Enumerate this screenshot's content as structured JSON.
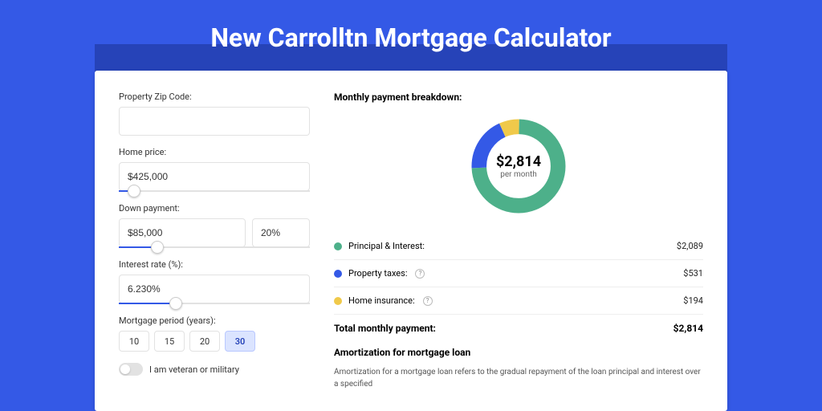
{
  "title": "New Carrolltn Mortgage Calculator",
  "form": {
    "zip": {
      "label": "Property Zip Code:",
      "value": ""
    },
    "price": {
      "label": "Home price:",
      "value": "$425,000",
      "slider_pct": 8
    },
    "down": {
      "label": "Down payment:",
      "amount": "$85,000",
      "pct": "20%",
      "slider_pct": 20
    },
    "rate": {
      "label": "Interest rate (%):",
      "value": "6.230%",
      "slider_pct": 30
    },
    "period": {
      "label": "Mortgage period (years):",
      "options": [
        "10",
        "15",
        "20",
        "30"
      ],
      "selected": "30"
    },
    "veteran": {
      "label": "I am veteran or military",
      "on": false
    }
  },
  "breakdown": {
    "title": "Monthly payment breakdown:",
    "center_amount": "$2,814",
    "center_sub": "per month",
    "items": [
      {
        "label": "Principal & Interest:",
        "value": "$2,089",
        "color": "green",
        "info": false
      },
      {
        "label": "Property taxes:",
        "value": "$531",
        "color": "blue",
        "info": true
      },
      {
        "label": "Home insurance:",
        "value": "$194",
        "color": "yellow",
        "info": true
      }
    ],
    "total_label": "Total monthly payment:",
    "total_value": "$2,814"
  },
  "chart_data": {
    "type": "pie",
    "title": "Monthly payment breakdown",
    "series": [
      {
        "name": "Principal & Interest",
        "value": 2089,
        "color": "#4db08a"
      },
      {
        "name": "Property taxes",
        "value": 531,
        "color": "#3459e6"
      },
      {
        "name": "Home insurance",
        "value": 194,
        "color": "#f0c94a"
      }
    ],
    "total": 2814,
    "inner_radius_pct": 62
  },
  "amort": {
    "title": "Amortization for mortgage loan",
    "text": "Amortization for a mortgage loan refers to the gradual repayment of the loan principal and interest over a specified"
  }
}
